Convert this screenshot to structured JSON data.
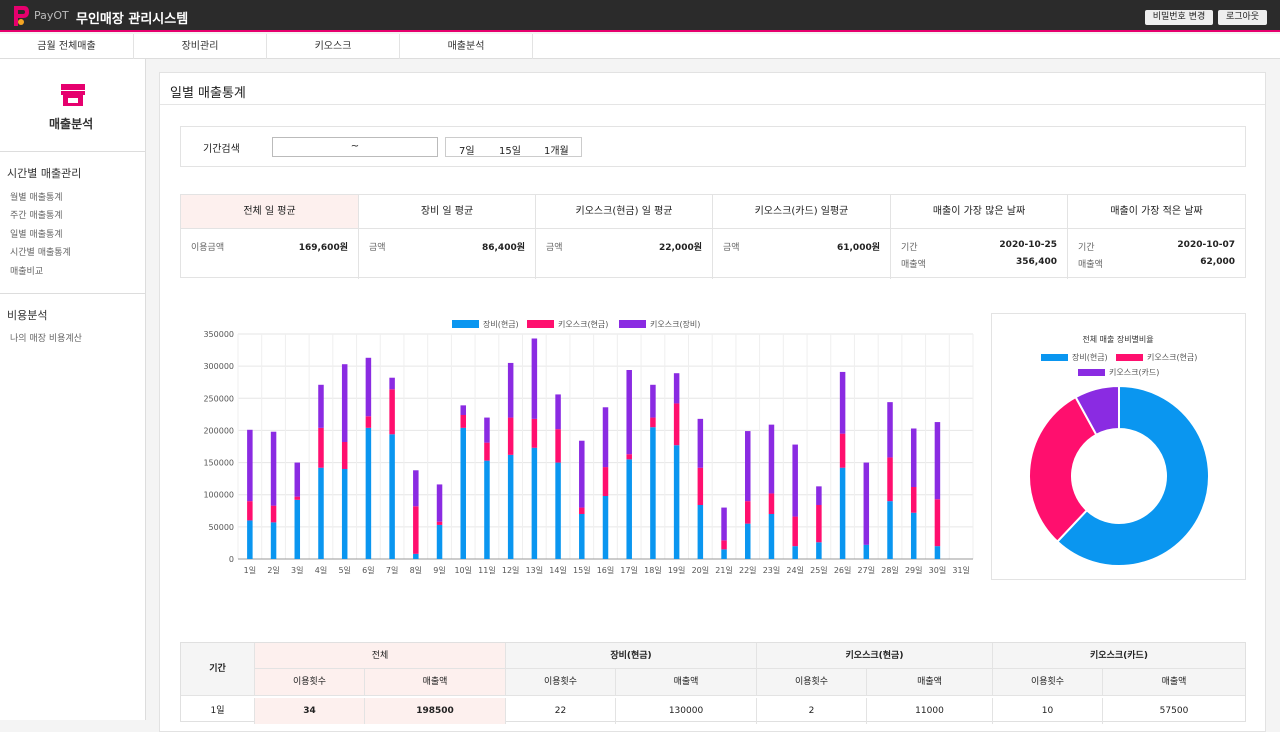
{
  "header": {
    "brand": "PayOT",
    "title": "무인매장 관리시스템",
    "buttons": [
      "비밀번호 변경",
      "로그아웃"
    ]
  },
  "nav": {
    "tabs": [
      "금월 전체매출",
      "장비관리",
      "키오스크",
      "매출분석"
    ]
  },
  "sidebar": {
    "title": "매출분석",
    "group1": "시간별 매출관리",
    "group1_items": [
      "월별 매출통계",
      "주간 매출통계",
      "일별 매출통계",
      "시간별 매출통계",
      "매출비교"
    ],
    "group2": "비용분석",
    "group2_items": [
      "나의 매장 비용계산"
    ]
  },
  "page_title": "일별 매출통계",
  "search": {
    "label": "기간검색",
    "range_value": "~",
    "quick": [
      "7일",
      "15일",
      "1개월"
    ]
  },
  "stats": [
    {
      "header": "전체 일 평균",
      "rows": [
        {
          "k": "이용금액",
          "v": "169,600원"
        }
      ]
    },
    {
      "header": "장비 일 평균",
      "rows": [
        {
          "k": "금액",
          "v": "86,400원"
        }
      ]
    },
    {
      "header": "키오스크(현금) 일 평균",
      "rows": [
        {
          "k": "금액",
          "v": "22,000원"
        }
      ]
    },
    {
      "header": "키오스크(카드) 일평균",
      "rows": [
        {
          "k": "금액",
          "v": "61,000원"
        }
      ]
    },
    {
      "header": "매출이 가장 많은 날짜",
      "rows": [
        {
          "k": "기간",
          "v": "2020-10-25"
        },
        {
          "k": "매출액",
          "v": "356,400"
        }
      ]
    },
    {
      "header": "매출이 가장 적은 날짜",
      "rows": [
        {
          "k": "기간",
          "v": "2020-10-07"
        },
        {
          "k": "매출액",
          "v": "62,000"
        }
      ]
    }
  ],
  "chart_data": [
    {
      "type": "bar",
      "stacked": true,
      "categories": [
        "1일",
        "2일",
        "3일",
        "4일",
        "5일",
        "6일",
        "7일",
        "8일",
        "9일",
        "10일",
        "11일",
        "12일",
        "13일",
        "14일",
        "15일",
        "16일",
        "17일",
        "18일",
        "19일",
        "20일",
        "21일",
        "22일",
        "23일",
        "24일",
        "25일",
        "26일",
        "27일",
        "28일",
        "29일",
        "30일",
        "31일"
      ],
      "series": [
        {
          "name": "장비(현금)",
          "color": "#0a96f0",
          "values": [
            60000,
            57000,
            92000,
            142000,
            140000,
            204000,
            194000,
            8000,
            53000,
            204000,
            153000,
            162000,
            173000,
            150000,
            70000,
            98000,
            155000,
            205000,
            177000,
            84000,
            15000,
            55000,
            70000,
            20000,
            26000,
            142000,
            22000,
            90000,
            72000,
            20000,
            0
          ]
        },
        {
          "name": "키오스크(현금)",
          "color": "#ff0f6e",
          "values": [
            30000,
            26000,
            5000,
            62000,
            42000,
            18000,
            70000,
            74000,
            5000,
            20000,
            28000,
            58000,
            45000,
            52000,
            10000,
            45000,
            8000,
            15000,
            65000,
            58000,
            14000,
            35000,
            32000,
            46000,
            58000,
            53000,
            0,
            68000,
            40000,
            73000,
            0
          ]
        },
        {
          "name": "키오스크(장비)",
          "color": "#8a2be2",
          "values": [
            111000,
            115000,
            53000,
            67000,
            121000,
            91000,
            18000,
            56000,
            58000,
            15000,
            39000,
            85000,
            125000,
            54000,
            104000,
            93000,
            131000,
            51000,
            47000,
            76000,
            51000,
            109000,
            107000,
            112000,
            29000,
            96000,
            128000,
            86000,
            91000,
            120000,
            0
          ]
        }
      ],
      "ylim": [
        0,
        350000
      ],
      "yticks": [
        "350000",
        "300000",
        "250000",
        "200000",
        "150000",
        "100000",
        "50000",
        "0"
      ],
      "legend": "top"
    },
    {
      "type": "pie",
      "donut": true,
      "title": "전체 매출 장비별비율",
      "labels": [
        "장비(현금)",
        "키오스크(현금)",
        "키오스크(카드)"
      ],
      "colors": [
        "#0a96f0",
        "#ff0f6e",
        "#8a2be2"
      ],
      "values": [
        62,
        30,
        8
      ],
      "legend": "top"
    }
  ],
  "table": {
    "period_header": "기간",
    "groups": [
      "전체",
      "장비(현금)",
      "키오스크(현금)",
      "키오스크(카드)"
    ],
    "subheaders": [
      "이용횟수",
      "매출액"
    ],
    "rows": [
      {
        "period": "1일",
        "cells": [
          "34",
          "198500",
          "22",
          "130000",
          "2",
          "11000",
          "10",
          "57500"
        ]
      }
    ]
  }
}
